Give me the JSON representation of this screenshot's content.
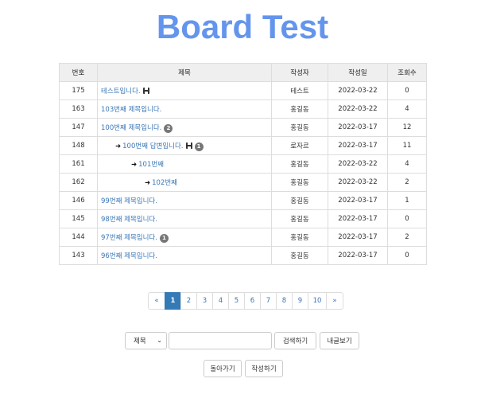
{
  "page": {
    "title": "Board Test"
  },
  "table": {
    "headers": [
      "번호",
      "제목",
      "작성자",
      "작성일",
      "조회수"
    ],
    "rows": [
      {
        "no": "175",
        "title": "테스트입니다.",
        "depth": 0,
        "attach": true,
        "comments": "",
        "author": "테스트",
        "date": "2022-03-22",
        "views": "0"
      },
      {
        "no": "163",
        "title": "103번째 제목입니다.",
        "depth": 0,
        "attach": false,
        "comments": "",
        "author": "홍길동",
        "date": "2022-03-22",
        "views": "4"
      },
      {
        "no": "147",
        "title": "100번째 제목입니다.",
        "depth": 0,
        "attach": false,
        "comments": "2",
        "author": "홍길동",
        "date": "2022-03-17",
        "views": "12"
      },
      {
        "no": "148",
        "title": "100번째 답변입니다.",
        "depth": 1,
        "attach": true,
        "comments": "1",
        "author": "로자르",
        "date": "2022-03-17",
        "views": "11"
      },
      {
        "no": "161",
        "title": "101번째",
        "depth": 2,
        "attach": false,
        "comments": "",
        "author": "홍길동",
        "date": "2022-03-22",
        "views": "4"
      },
      {
        "no": "162",
        "title": "102번째",
        "depth": 3,
        "attach": false,
        "comments": "",
        "author": "홍길동",
        "date": "2022-03-22",
        "views": "2"
      },
      {
        "no": "146",
        "title": "99번째 제목입니다.",
        "depth": 0,
        "attach": false,
        "comments": "",
        "author": "홍길동",
        "date": "2022-03-17",
        "views": "1"
      },
      {
        "no": "145",
        "title": "98번째 제목입니다.",
        "depth": 0,
        "attach": false,
        "comments": "",
        "author": "홍길동",
        "date": "2022-03-17",
        "views": "0"
      },
      {
        "no": "144",
        "title": "97번째 제목입니다.",
        "depth": 0,
        "attach": false,
        "comments": "1",
        "author": "홍길동",
        "date": "2022-03-17",
        "views": "2"
      },
      {
        "no": "143",
        "title": "96번째 제목입니다.",
        "depth": 0,
        "attach": false,
        "comments": "",
        "author": "홍길동",
        "date": "2022-03-17",
        "views": "0"
      }
    ],
    "reply_arrow": "➜"
  },
  "pagination": {
    "prev": "«",
    "pages": [
      "1",
      "2",
      "3",
      "4",
      "5",
      "6",
      "7",
      "8",
      "9",
      "10"
    ],
    "active": "1",
    "next": "»"
  },
  "search": {
    "field_selected": "제목",
    "query_value": "",
    "search_button": "검색하기",
    "my_posts_button": "내글보기"
  },
  "actions": {
    "back_button": "돌아가기",
    "write_button": "작성하기"
  },
  "colors": {
    "title": "#6495ed",
    "link": "#3a77b7",
    "active_page": "#337ab7",
    "badge": "#777777",
    "header_bg": "#efefef"
  },
  "icons": {
    "attachment": "floppy-disk-icon",
    "dropdown": "chevron-down-icon",
    "reply": "reply-arrow-icon"
  }
}
